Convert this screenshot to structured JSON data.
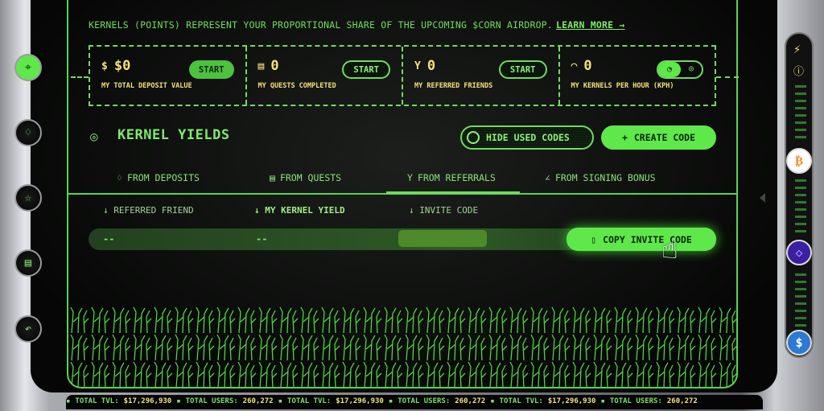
{
  "notice": {
    "text": "KERNELS (POINTS) REPRESENT YOUR PROPORTIONAL SHARE OF THE UPCOMING $CORN AIRDROP.",
    "link": "LEARN MORE →"
  },
  "stats": [
    {
      "icon": "dollar-coin-icon",
      "value": "$0",
      "label": "MY TOTAL DEPOSIT VALUE",
      "button": "START"
    },
    {
      "icon": "scroll-icon",
      "value": "0",
      "label": "MY QUESTS COMPLETED",
      "button": "START"
    },
    {
      "icon": "person-icon",
      "value": "0",
      "label": "MY REFERRED FRIENDS",
      "button": "START"
    },
    {
      "icon": "gauge-icon",
      "value": "0",
      "label": "MY KERNELS PER HOUR (KPH)"
    }
  ],
  "section": {
    "title": "KERNEL YIELDS",
    "hide_used": "HIDE USED CODES",
    "create": "CREATE CODE"
  },
  "tabs": [
    {
      "label": "FROM DEPOSITS",
      "icon": "drop-icon"
    },
    {
      "label": "FROM QUESTS",
      "icon": "scroll-icon"
    },
    {
      "label": "FROM REFERRALS",
      "icon": "person-icon",
      "active": true
    },
    {
      "label": "FROM SIGNING BONUS",
      "icon": "pen-icon"
    }
  ],
  "table": {
    "headers": [
      "↓ REFERRED FRIEND",
      "↓ MY KERNEL YIELD",
      "↓ INVITE CODE"
    ],
    "row": {
      "friend": "--",
      "yield": "--",
      "code": ""
    },
    "copy": "COPY INVITE CODE"
  },
  "ticker": {
    "tvl_label": "TOTAL TVL:",
    "tvl": "$17,296,930",
    "users_label": "TOTAL USERS:",
    "users": "260,272"
  },
  "colors": {
    "accent": "#5ee84a",
    "yellow": "#f3e27a",
    "bg": "#050605"
  }
}
